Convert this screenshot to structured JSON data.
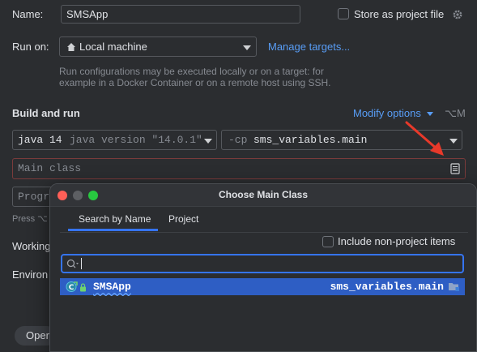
{
  "name": {
    "label": "Name:",
    "value": "SMSApp"
  },
  "store_project_file": {
    "label": "Store as project file"
  },
  "run_on": {
    "label": "Run on:",
    "target": "Local machine",
    "manage_link": "Manage targets...",
    "description_line1": "Run configurations may be executed locally or on a target: for",
    "description_line2": "example in a Docker Container or on a remote host using SSH."
  },
  "build_and_run": {
    "title": "Build and run",
    "modify_options": "Modify options",
    "modify_shortcut": "⌥M",
    "jdk_name": "java 14",
    "jdk_version": "java version \"14.0.1\"",
    "cp_prefix": "-cp",
    "cp_module": "sms_variables.main",
    "main_class_placeholder": "Main class",
    "program_args_partial": "Progra",
    "press_hint_partial": "Press ⌥"
  },
  "left_labels": {
    "working_partial": "Working",
    "environ_partial": "Environ",
    "open_partial": "Oper"
  },
  "popup": {
    "title": "Choose Main Class",
    "tabs": [
      "Search by Name",
      "Project"
    ],
    "include_non_project": "Include non-project items",
    "search_value": "",
    "results": [
      {
        "class_name": "SMSApp",
        "module": "sms_variables.main"
      }
    ]
  },
  "colors": {
    "background": "#2b2d30",
    "accent": "#3574f0",
    "link": "#589df6",
    "error_border": "#7a3b3b",
    "selection": "#2e5ec4",
    "arrow": "#e8392a"
  }
}
